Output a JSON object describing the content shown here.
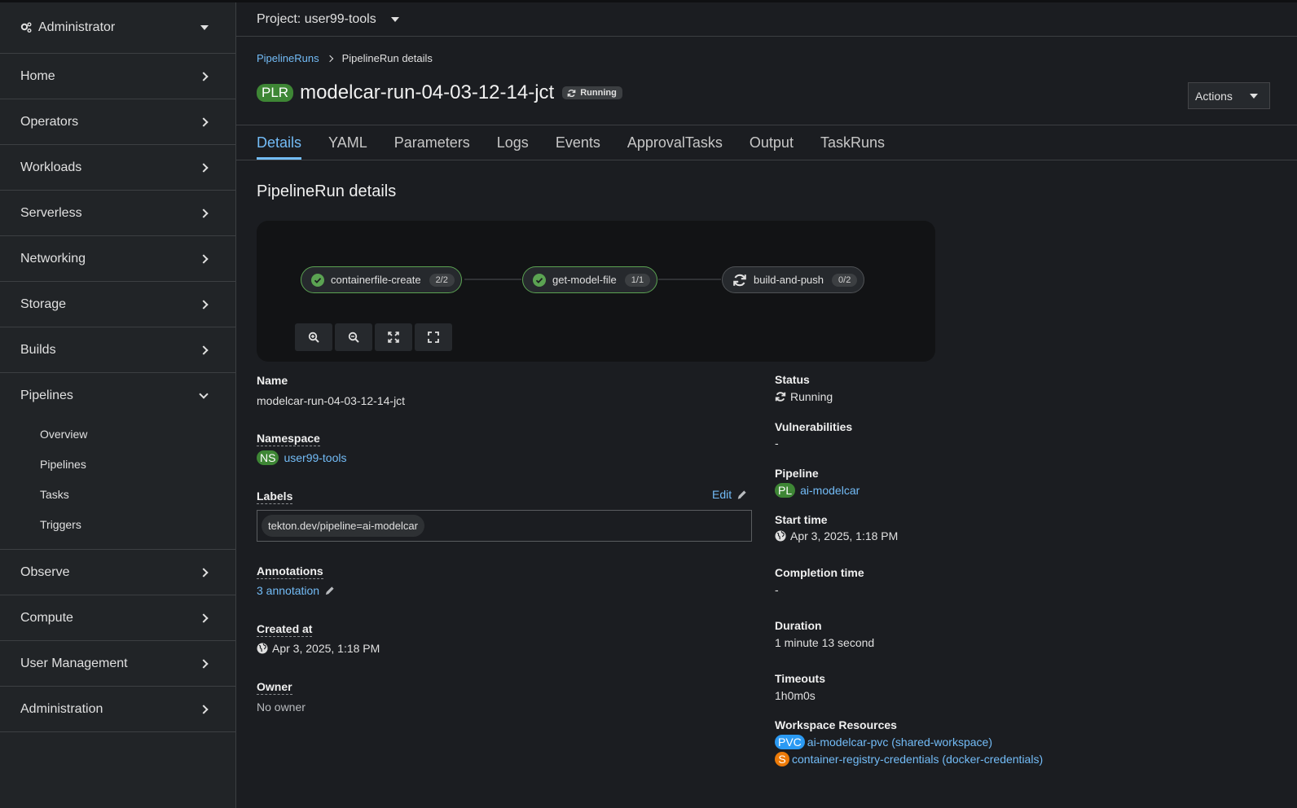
{
  "sidebar": {
    "perspective": "Administrator",
    "items": [
      {
        "label": "Home"
      },
      {
        "label": "Operators"
      },
      {
        "label": "Workloads"
      },
      {
        "label": "Serverless"
      },
      {
        "label": "Networking"
      },
      {
        "label": "Storage"
      },
      {
        "label": "Builds"
      }
    ],
    "pipelines": {
      "label": "Pipelines",
      "sub": [
        "Overview",
        "Pipelines",
        "Tasks",
        "Triggers"
      ]
    },
    "items_after": [
      {
        "label": "Observe"
      },
      {
        "label": "Compute"
      },
      {
        "label": "User Management"
      },
      {
        "label": "Administration"
      }
    ]
  },
  "project": {
    "label": "Project: user99-tools"
  },
  "breadcrumb": {
    "parent": "PipelineRuns",
    "current": "PipelineRun details"
  },
  "header": {
    "badge": "PLR",
    "title": "modelcar-run-04-03-12-14-jct",
    "status": "Running",
    "actions_label": "Actions"
  },
  "tabs": [
    "Details",
    "YAML",
    "Parameters",
    "Logs",
    "Events",
    "ApprovalTasks",
    "Output",
    "TaskRuns"
  ],
  "section_title": "PipelineRun details",
  "topology": {
    "nodes": [
      {
        "name": "containerfile-create",
        "count": "2/2",
        "state": "succeeded"
      },
      {
        "name": "get-model-file",
        "count": "1/1",
        "state": "succeeded"
      },
      {
        "name": "build-and-push",
        "count": "0/2",
        "state": "running"
      }
    ]
  },
  "details": {
    "name_label": "Name",
    "name_value": "modelcar-run-04-03-12-14-jct",
    "namespace_label": "Namespace",
    "namespace_badge": "NS",
    "namespace_value": "user99-tools",
    "labels_label": "Labels",
    "labels_edit": "Edit",
    "labels": [
      "tekton.dev/pipeline=ai-modelcar"
    ],
    "annotations_label": "Annotations",
    "annotations_value": "3 annotation",
    "created_label": "Created at",
    "created_value": "Apr 3, 2025, 1:18 PM",
    "owner_label": "Owner",
    "owner_value": "No owner"
  },
  "right": {
    "status_label": "Status",
    "status_value": "Running",
    "vuln_label": "Vulnerabilities",
    "vuln_value": "-",
    "pipeline_label": "Pipeline",
    "pipeline_badge": "PL",
    "pipeline_value": "ai-modelcar",
    "start_label": "Start time",
    "start_value": "Apr 3, 2025, 1:18 PM",
    "completion_label": "Completion time",
    "completion_value": "-",
    "duration_label": "Duration",
    "duration_value": "1 minute 13 second",
    "timeouts_label": "Timeouts",
    "timeouts_value": "1h0m0s",
    "workspace_label": "Workspace Resources",
    "pvc_badge": "PVC",
    "pvc_value": "ai-modelcar-pvc (shared-workspace)",
    "secret_badge": "S",
    "secret_value": "container-registry-credentials (docker-credentials)"
  },
  "colors": {
    "accent": "#73bcf7",
    "success": "#3e8635",
    "pvc": "#2b9af3",
    "secret": "#ec7a08"
  }
}
